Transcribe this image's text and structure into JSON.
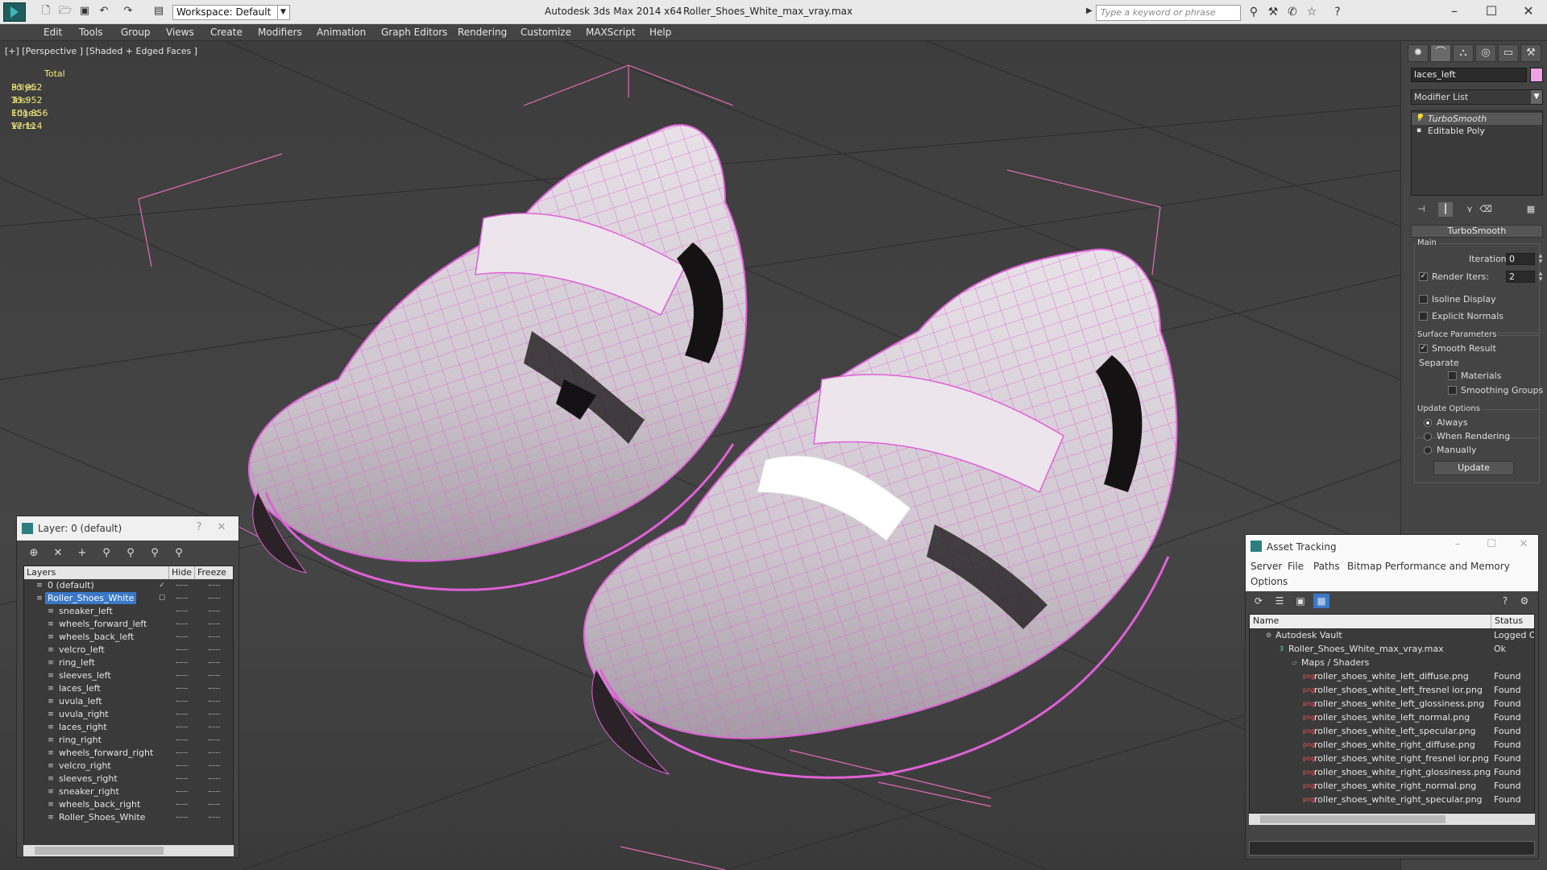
{
  "titlebar": {
    "workspace": "Workspace: Default",
    "app_title": "Autodesk 3ds Max  2014 x64",
    "file_title": "Roller_Shoes_White_max_vray.max",
    "search_placeholder": "Type a keyword or phrase"
  },
  "menu": [
    "Edit",
    "Tools",
    "Group",
    "Views",
    "Create",
    "Modifiers",
    "Animation",
    "Graph Editors",
    "Rendering",
    "Customize",
    "MAXScript",
    "Help"
  ],
  "viewport": {
    "label": "[+] [Perspective ] [Shaded + Edged Faces ]",
    "stats_total_label": "Total",
    "stats": [
      {
        "label": "Polys:",
        "value": "33 952"
      },
      {
        "label": "Tris:",
        "value": "33 952"
      },
      {
        "label": "Edges:",
        "value": "101 856"
      },
      {
        "label": "Verts:",
        "value": "17 114"
      }
    ]
  },
  "command_panel": {
    "object_name": "laces_left",
    "object_color": "#f2a0e6",
    "modifier_list": "Modifier List",
    "stack": [
      "TurboSmooth",
      "Editable Poly"
    ],
    "rollout_title": "TurboSmooth",
    "main_group": "Main",
    "iterations_label": "Iterations:",
    "iterations_value": "0",
    "render_iters_label": "Render Iters:",
    "render_iters_value": "2",
    "render_iters_checked": true,
    "isoline_label": "Isoline Display",
    "explicit_normals_label": "Explicit Normals",
    "surface_group": "Surface Parameters",
    "smooth_result_label": "Smooth Result",
    "separate_label": "Separate",
    "materials_label": "Materials",
    "smoothing_groups_label": "Smoothing Groups",
    "update_group": "Update Options",
    "update_options": [
      "Always",
      "When Rendering",
      "Manually"
    ],
    "update_selected": "Always",
    "update_button": "Update"
  },
  "layer_window": {
    "title": "Layer: 0 (default)",
    "help": "?",
    "close": "✕",
    "columns": [
      "Layers",
      "Hide",
      "Freeze"
    ],
    "rows": [
      {
        "name": "0 (default)",
        "level": 0,
        "checked": true
      },
      {
        "name": "Roller_Shoes_White",
        "level": 0,
        "selected": true
      },
      {
        "name": "sneaker_left",
        "level": 1
      },
      {
        "name": "wheels_forward_left",
        "level": 1
      },
      {
        "name": "wheels_back_left",
        "level": 1
      },
      {
        "name": "velcro_left",
        "level": 1
      },
      {
        "name": "ring_left",
        "level": 1
      },
      {
        "name": "sleeves_left",
        "level": 1
      },
      {
        "name": "laces_left",
        "level": 1
      },
      {
        "name": "uvula_left",
        "level": 1
      },
      {
        "name": "uvula_right",
        "level": 1
      },
      {
        "name": "laces_right",
        "level": 1
      },
      {
        "name": "ring_right",
        "level": 1
      },
      {
        "name": "wheels_forward_right",
        "level": 1
      },
      {
        "name": "velcro_right",
        "level": 1
      },
      {
        "name": "sleeves_right",
        "level": 1
      },
      {
        "name": "sneaker_right",
        "level": 1
      },
      {
        "name": "wheels_back_right",
        "level": 1
      },
      {
        "name": "Roller_Shoes_White",
        "level": 1
      }
    ]
  },
  "asset_window": {
    "title": "Asset Tracking",
    "menu": [
      "Server",
      "File",
      "Paths",
      "Bitmap Performance and Memory",
      "Options"
    ],
    "columns": [
      "Name",
      "Status"
    ],
    "rows": [
      {
        "name": "Autodesk Vault",
        "status": "Logged Out",
        "level": 0,
        "kind": "vault"
      },
      {
        "name": "Roller_Shoes_White_max_vray.max",
        "status": "Ok",
        "level": 1,
        "kind": "max"
      },
      {
        "name": "Maps / Shaders",
        "status": "",
        "level": 2,
        "kind": "folder"
      },
      {
        "name": "roller_shoes_white_left_diffuse.png",
        "status": "Found",
        "level": 3,
        "kind": "png"
      },
      {
        "name": "roller_shoes_white_left_fresnel ior.png",
        "status": "Found",
        "level": 3,
        "kind": "png"
      },
      {
        "name": "roller_shoes_white_left_glossiness.png",
        "status": "Found",
        "level": 3,
        "kind": "png"
      },
      {
        "name": "roller_shoes_white_left_normal.png",
        "status": "Found",
        "level": 3,
        "kind": "png"
      },
      {
        "name": "roller_shoes_white_left_specular.png",
        "status": "Found",
        "level": 3,
        "kind": "png"
      },
      {
        "name": "roller_shoes_white_right_diffuse.png",
        "status": "Found",
        "level": 3,
        "kind": "png"
      },
      {
        "name": "roller_shoes_white_right_fresnel ior.png",
        "status": "Found",
        "level": 3,
        "kind": "png"
      },
      {
        "name": "roller_shoes_white_right_glossiness.png",
        "status": "Found",
        "level": 3,
        "kind": "png"
      },
      {
        "name": "roller_shoes_white_right_normal.png",
        "status": "Found",
        "level": 3,
        "kind": "png"
      },
      {
        "name": "roller_shoes_white_right_specular.png",
        "status": "Found",
        "level": 3,
        "kind": "png"
      }
    ]
  },
  "colors": {
    "wireframe": "#e060d8",
    "selection": "#3a78c8",
    "stats_text": "#f3e97a"
  }
}
